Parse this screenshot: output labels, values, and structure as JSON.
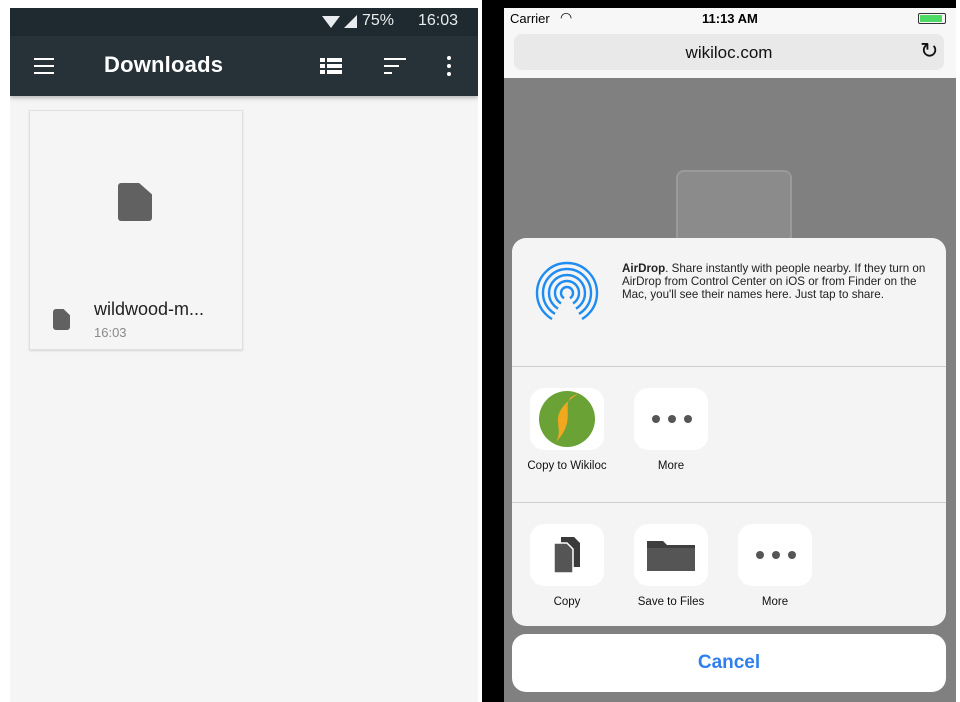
{
  "android": {
    "status_bar": {
      "battery": "75%",
      "time": "16:03"
    },
    "toolbar": {
      "title": "Downloads"
    },
    "file": {
      "name": "wildwood-m...",
      "time": "16:03"
    }
  },
  "ios": {
    "status_bar": {
      "carrier": "Carrier",
      "time": "11:13 AM"
    },
    "url_bar": {
      "domain": "wikiloc.com"
    },
    "share_sheet": {
      "airdrop": {
        "title": "AirDrop",
        "description": ". Share instantly with people nearby. If they turn on AirDrop from Control Center on iOS or from Finder on the Mac, you'll see their names here. Just tap to share."
      },
      "app_row": [
        {
          "label": "Copy to Wikiloc",
          "icon": "wikiloc-app-icon"
        },
        {
          "label": "More",
          "icon": "more-icon"
        }
      ],
      "action_row": [
        {
          "label": "Copy",
          "icon": "copy-icon"
        },
        {
          "label": "Save to Files",
          "icon": "folder-icon"
        },
        {
          "label": "More",
          "icon": "more-icon"
        }
      ],
      "cancel_label": "Cancel"
    },
    "colors": {
      "accent": "#2f80ed",
      "airdrop": "#1e8cf0",
      "wikiloc_green": "#6aa236",
      "wikiloc_orange": "#f2a81e"
    }
  }
}
